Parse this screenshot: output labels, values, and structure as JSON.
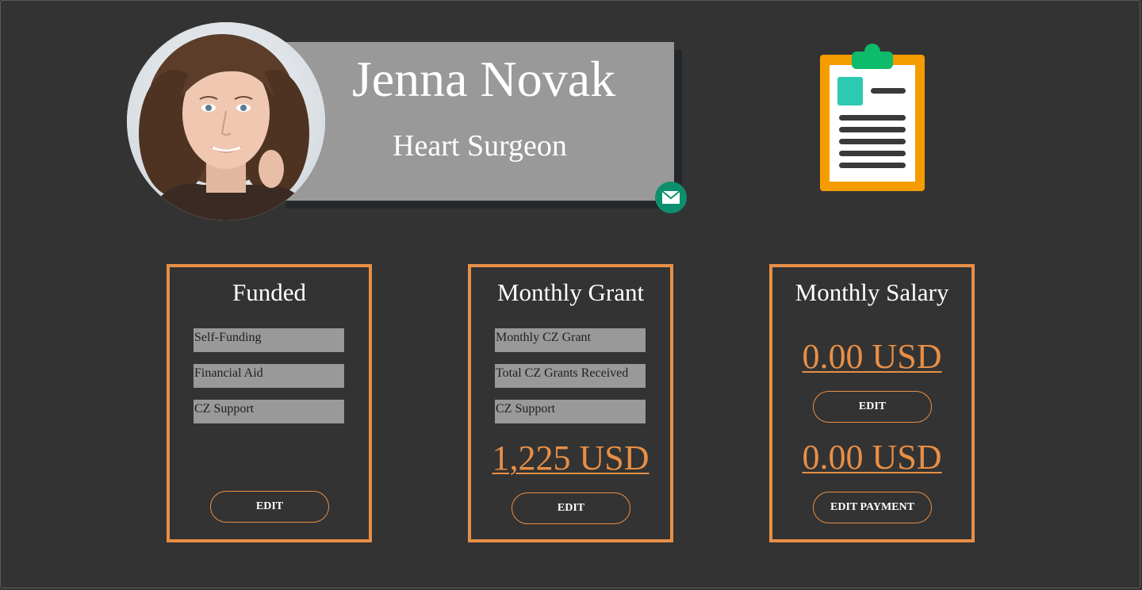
{
  "profile": {
    "name": "Jenna Novak",
    "title": "Heart Surgeon",
    "avatar_icon": "person-portrait",
    "mail_icon": "envelope-icon",
    "clipboard_icon": "clipboard-icon"
  },
  "colors": {
    "background": "#333333",
    "accent": "#e88f46",
    "card_fill": "#999999",
    "mail_button": "#0d8f6d"
  },
  "cards": {
    "funded": {
      "title": "Funded",
      "fields": [
        "Self-Funding",
        "Financial Aid",
        "CZ Support"
      ],
      "button": "EDIT"
    },
    "monthly_grant": {
      "title": "Monthly Grant",
      "fields": [
        "Monthly CZ Grant",
        "Total CZ Grants Received",
        "CZ Support"
      ],
      "amount": "1,225 USD",
      "button": "EDIT"
    },
    "monthly_salary": {
      "title": "Monthly Salary",
      "amount_1": "0.00 USD",
      "button_1": "EDIT",
      "amount_2": "0.00 USD",
      "button_2": "EDIT PAYMENT"
    }
  }
}
